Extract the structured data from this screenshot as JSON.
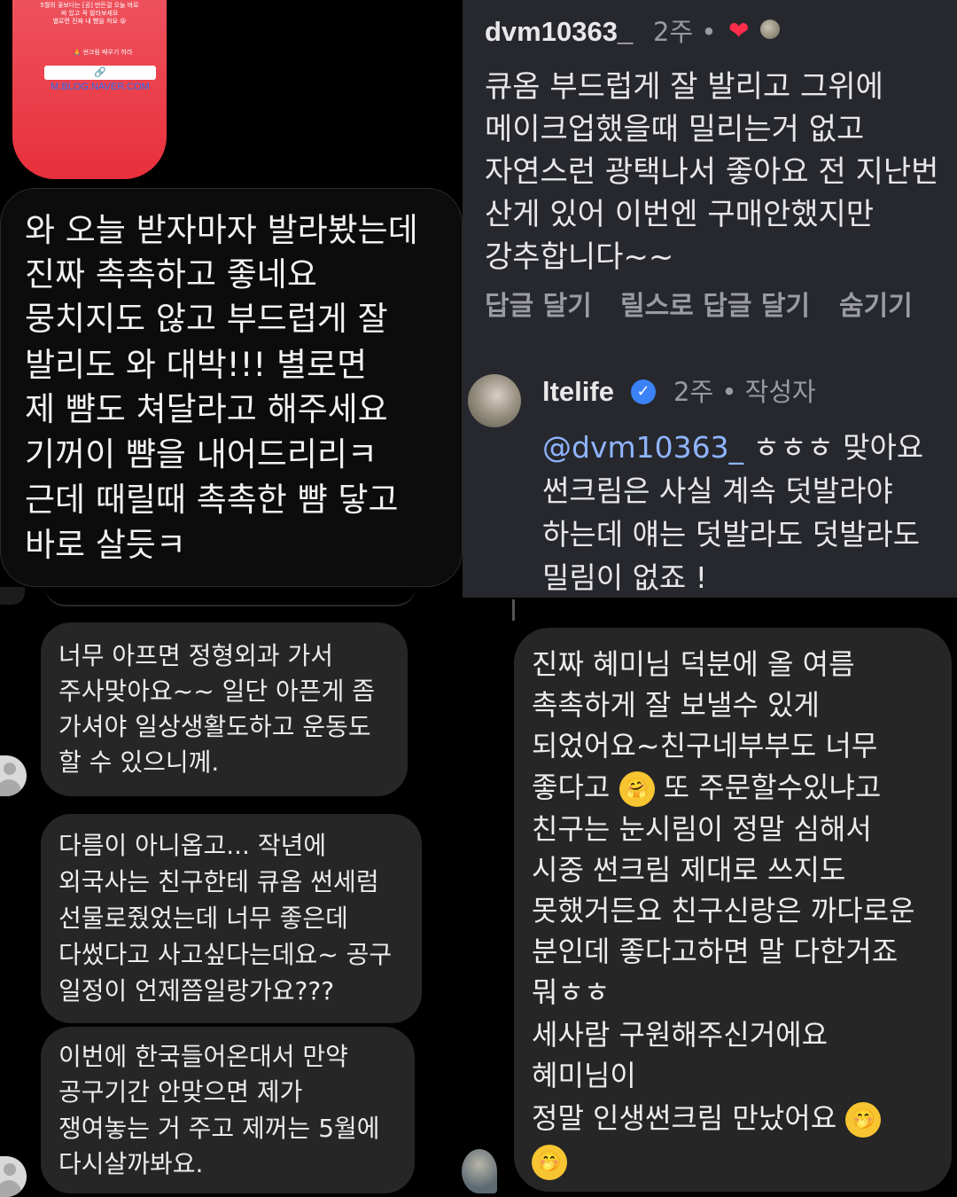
{
  "story": {
    "text_lines": [
      "5월의 꽃보다는 [공] 만든걸 오늘 바로",
      "써 있고 꼭 발라보세요",
      "별로면 진짜 내 뺨을 쳐요 😝"
    ],
    "chip_label": "🙏 썬크림 배우기 하라",
    "link_label": "🔗 M.BLOG.NAVER.COM"
  },
  "bubble_main": {
    "lines": [
      "와 오늘 받자마자 발라봤는데",
      "진짜 촉촉하고 좋네요",
      "뭉치지도 않고 부드럽게 잘",
      "발리도 와 대박!!! 별로면",
      "제 뺨도 쳐달라고 해주세요",
      "기꺼이 뺨을 내어드리리ㅋ",
      "근데 때릴때 촉촉한 뺨 닿고",
      "바로 살듯ㅋ"
    ]
  },
  "comment": {
    "username": "dvm10363_",
    "meta": "2주 •",
    "heart": "❤",
    "lines": [
      "큐옴 부드럽게 잘 발리고 그위에",
      "메이크업했을때 밀리는거 없고",
      "자연스런 광택나서 좋아요 전 지난번",
      "산게 있어 이번엔 구매안했지만",
      "강추합니다~~"
    ],
    "actions": [
      "답글 달기",
      "릴스로 답글 달기",
      "숨기기"
    ]
  },
  "reply": {
    "username": "ltelife",
    "verified": "✓",
    "meta": "2주 • 작성자",
    "mention": "@dvm10363_",
    "first_line_rest": " ㅎㅎㅎ 맞아요",
    "lines": [
      "썬크림은 사실 계속 덧발라야",
      "하는데 얘는 덧발라도 덧발라도",
      "밀림이 없죠 !"
    ]
  },
  "chat_left": [
    {
      "lines": [
        "너무 아프면 정형외과 가서",
        "주사맞아요~~ 일단 아픈게 좀",
        "가셔야 일상생활도하고 운동도",
        "할 수 있으니께."
      ]
    },
    {
      "lines": [
        "다름이 아니옵고... 작년에",
        "외국사는 친구한테 큐옴 썬세럼",
        "선물로줬었는데 너무 좋은데",
        "다썼다고 사고싶다는데요~ 공구",
        "일정이 언제쯤일랑가요???"
      ]
    },
    {
      "lines": [
        "이번에 한국들어온대서 만약",
        "공구기간 안맞으면 제가",
        "쟁여놓는 거 주고 제꺼는 5월에",
        "다시살까봐요."
      ]
    }
  ],
  "chat_right": {
    "lines": [
      "진짜 혜미님 덕분에 올 여름",
      "촉촉하게 잘 보낼수 있게",
      "되었어요~친구네부부도 너무",
      "좋다고",
      "친구는 눈시림이 정말 심해서",
      "시중 썬크림 제대로 쓰지도",
      "못했거든요 친구신랑은 까다로운",
      "분인데 좋다고하면 말 다한거죠",
      "뭐ㅎㅎ",
      "세사람 구원해주신거에요",
      "혜미님이",
      "정말 인생썬크림 만났어요"
    ],
    "line4_rest": " 또 주문할수있냐고",
    "emoji_hug": "🤗",
    "emoji_shy": "🤭"
  }
}
